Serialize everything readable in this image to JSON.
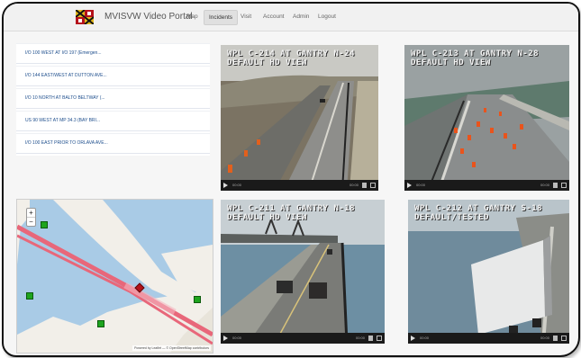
{
  "navbar": {
    "brand": "MVISVW Video Portal",
    "links": [
      {
        "label": "Map",
        "active": false
      },
      {
        "label": "Incidents",
        "active": true
      },
      {
        "label": "Visit",
        "active": false
      },
      {
        "label": "Account",
        "active": false
      },
      {
        "label": "Admin",
        "active": false
      },
      {
        "label": "Logout",
        "active": false
      }
    ]
  },
  "incidents": [
    "I/O 100 WEST AT I/O 197 (Emergen...",
    "I/O 144 EAST/WEST AT DUTTON AVE...",
    "I/O 10 NORTH AT BALTO BELTWAY (...",
    "US 90 WEST AT MP 34.3 (BAY BRI...",
    "I/O 100 EAST PRIOR TO ORLAVA AVE..."
  ],
  "map": {
    "zoom_in": "+",
    "zoom_out": "−",
    "attribution": "Powered by Leaflet — © OpenStreetMap contributors"
  },
  "cameras": [
    {
      "line1": "WPL C-214 AT GANTRY N-24",
      "line2": "DEFAULT HD VIEW",
      "time": "00:00",
      "time2": "00:00"
    },
    {
      "line1": "WPL C-213 AT GANTRY N-28",
      "line2": "DEFAULT HD VIEW",
      "time": "00:00",
      "time2": "00:00"
    },
    {
      "line1": "WPL C-211 AT GANTRY N-18",
      "line2": "DEFAULT HD VIEW",
      "time": "00:00",
      "time2": "00:00"
    },
    {
      "line1": "WPL C-212 AT GANTRY S-18",
      "line2": "DEFAULT/TESTED",
      "time": "00:00",
      "time2": "00:00"
    }
  ],
  "colors": {
    "link": "#1c4d8c",
    "map_water": "#a9cbe6",
    "map_land": "#f2efe9",
    "road": "#e8677a",
    "marker_green": "#1ea41e",
    "marker_red": "#b3121a"
  },
  "icons": [
    "maryland-flag-logo",
    "play-icon",
    "volume-icon",
    "fullscreen-icon"
  ]
}
